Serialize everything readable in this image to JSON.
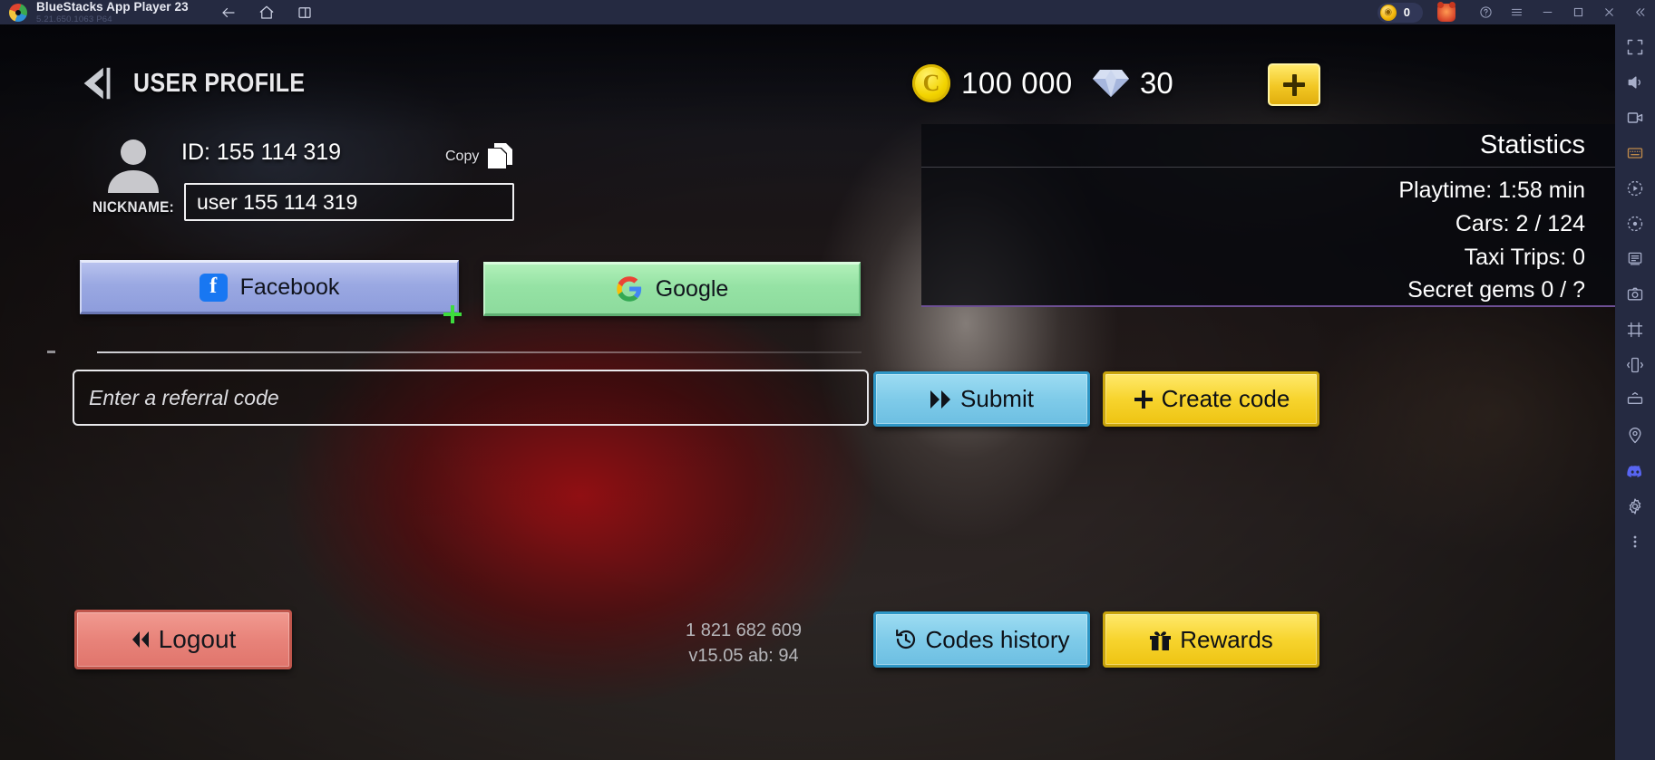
{
  "titlebar": {
    "app_name": "BlueStacks App Player 23",
    "version": "5.21.650.1063  P64",
    "nav_icons": [
      "back-icon",
      "home-icon",
      "multi-instance-icon"
    ],
    "coin_pill": {
      "icon": "bluestacks-coin-icon",
      "value": "0"
    },
    "mascot": "bear-mascot-icon",
    "window_buttons": [
      "help-icon",
      "menu-icon",
      "minimize-icon",
      "maximize-icon",
      "close-icon",
      "collapse-icon"
    ]
  },
  "sidebar": {
    "items": [
      {
        "icon": "fullscreen-icon",
        "name": "fullscreen"
      },
      {
        "icon": "volume-icon",
        "name": "volume"
      },
      {
        "icon": "video-icon",
        "name": "media-manager"
      },
      {
        "icon": "keyboard-icon",
        "name": "game-controls"
      },
      {
        "icon": "record-icon",
        "name": "screen-record"
      },
      {
        "icon": "macro-icon",
        "name": "macro-recorder"
      },
      {
        "icon": "multi-instance-icon",
        "name": "multi-instance-manager"
      },
      {
        "icon": "screenshot-icon",
        "name": "screenshot"
      },
      {
        "icon": "crop-icon",
        "name": "crop-screenshot"
      },
      {
        "icon": "shake-icon",
        "name": "shake"
      },
      {
        "icon": "rotate-icon",
        "name": "rotate"
      },
      {
        "icon": "location-icon",
        "name": "location"
      },
      {
        "icon": "discord-icon",
        "name": "discord"
      },
      {
        "icon": "gear-icon",
        "name": "settings"
      },
      {
        "icon": "more-icon",
        "name": "more"
      }
    ]
  },
  "game": {
    "header": {
      "back_icon": "back-arrow-icon",
      "title": "USER PROFILE",
      "coin": {
        "icon": "coin-icon",
        "value": "100 000"
      },
      "gem": {
        "icon": "gem-icon",
        "value": "30"
      },
      "add_button": {
        "icon": "plus-icon",
        "label": ""
      }
    },
    "profile": {
      "avatar_icon": "avatar-icon",
      "nickname_label": "NICKNAME:",
      "id_text": "ID: 155 114 319",
      "copy_label": "Copy",
      "copy_icon": "copy-icon",
      "nickname_value": "user 155 114 319"
    },
    "social": {
      "facebook": {
        "label": "Facebook",
        "icon": "facebook-icon",
        "color": "#9aa8e2"
      },
      "google": {
        "label": "Google",
        "icon": "google-icon",
        "color": "#95e2a4"
      }
    },
    "referral": {
      "placeholder": "Enter a referral code",
      "value": "",
      "submit_label": "Submit",
      "submit_icon": "double-arrow-icon",
      "create_label": "Create code",
      "create_icon": "plus-icon"
    },
    "statistics": {
      "title": "Statistics",
      "rows": [
        "Playtime: 1:58 min",
        "Cars: 2 / 124",
        "Taxi Trips: 0",
        "Secret gems 0 / ?"
      ]
    },
    "footer": {
      "logout_label": "Logout",
      "logout_icon": "double-arrow-left-icon",
      "version_line1": "1 821 682 609",
      "version_line2": "v15.05 ab: 94",
      "codes_history_label": "Codes history",
      "codes_history_icon": "history-icon",
      "rewards_label": "Rewards",
      "rewards_icon": "gift-icon"
    }
  },
  "colors": {
    "titlebar_bg": "#252a41",
    "accent_yellow": "#f7d42e",
    "accent_blue": "#7fcbe9",
    "accent_red": "#e8837a",
    "stats_underline": "#6d4f94"
  }
}
